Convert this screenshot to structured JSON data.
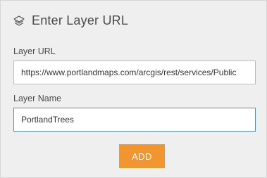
{
  "dialog": {
    "title": "Enter Layer URL",
    "icon": "layers-icon"
  },
  "layer_url": {
    "label": "Layer URL",
    "value": "https://www.portlandmaps.com/arcgis/rest/services/Public"
  },
  "layer_name": {
    "label": "Layer Name",
    "value": "PortlandTrees"
  },
  "add_button": {
    "label": "ADD",
    "color": "#f0952f"
  },
  "colors": {
    "panel_bg": "#efefef",
    "focus_border": "#4b8fc9",
    "text": "#4a4a4a"
  }
}
